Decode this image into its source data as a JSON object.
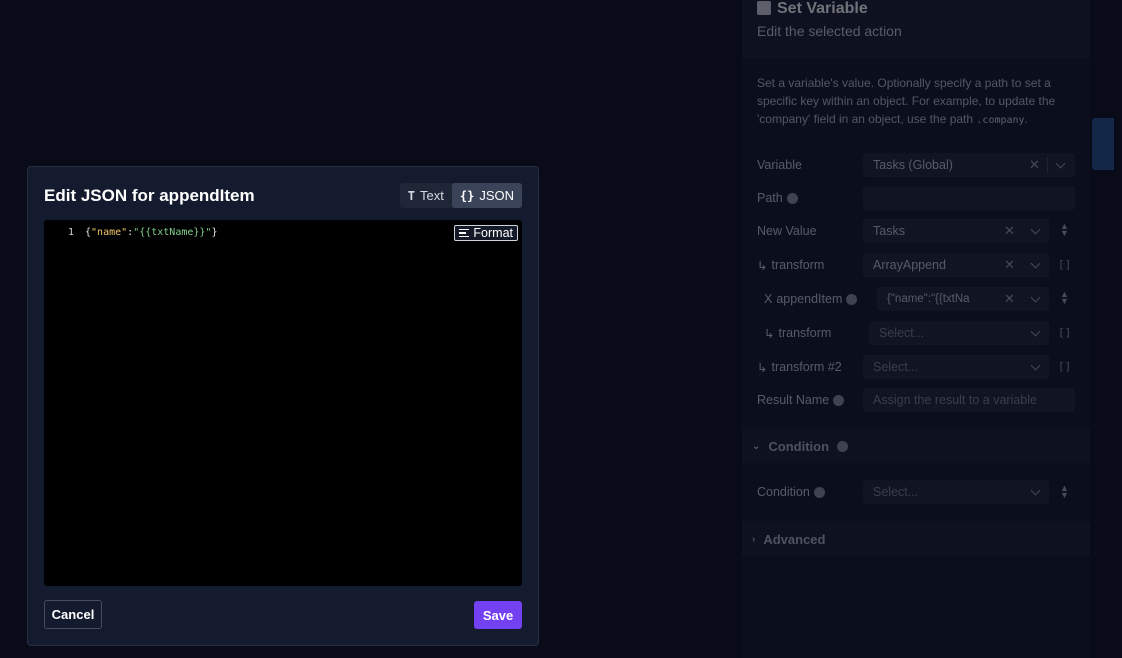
{
  "panel": {
    "title": "Set Variable",
    "subtitle": "Edit the selected action",
    "description": "Set a variable's value. Optionally specify a path to set a specific key within an object. For example, to update the 'company' field in an object, use the path",
    "description_code": ".company",
    "description_end": ".",
    "rows": {
      "variable": {
        "label": "Variable",
        "value": "Tasks (Global)"
      },
      "path": {
        "label": "Path",
        "value": ""
      },
      "new_value": {
        "label": "New Value",
        "value": "Tasks"
      },
      "transform1": {
        "label": "transform",
        "value": "ArrayAppend"
      },
      "append_item": {
        "label": "appendItem",
        "value": "{\"name\":\"{{txtNa"
      },
      "transform2": {
        "label": "transform",
        "value": "Select..."
      },
      "transform3": {
        "label": "transform #2",
        "value": "Select..."
      },
      "result_name": {
        "label": "Result Name",
        "placeholder": "Assign the result to a variable"
      }
    },
    "condition_section": "Condition",
    "condition_row": {
      "label": "Condition",
      "value": "Select..."
    },
    "advanced_section": "Advanced"
  },
  "modal": {
    "title": "Edit JSON for appendItem",
    "toggle_text": "Text",
    "toggle_json": "JSON",
    "toggle_active": "JSON",
    "format_label": "Format",
    "line_number": "1",
    "code": {
      "brace_open": "{",
      "key": "\"name\"",
      "colon": ":",
      "value": "\"{{txtName}}\"",
      "brace_close": "}"
    },
    "cancel_label": "Cancel",
    "save_label": "Save"
  },
  "colors": {
    "save_bg": "#7441f2",
    "editor_bg": "#000000",
    "json_key": "#f3c76b",
    "json_string": "#7fd08a"
  }
}
